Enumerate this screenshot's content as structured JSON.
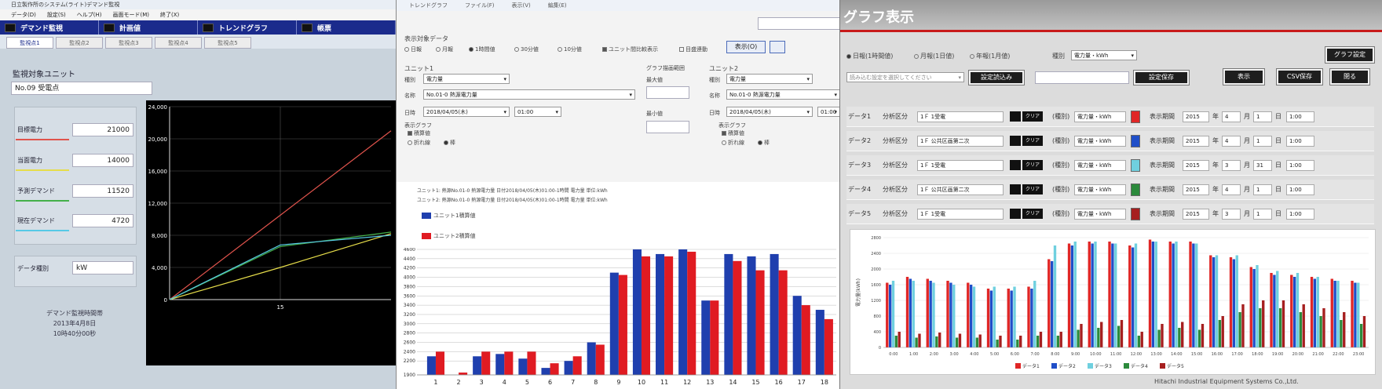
{
  "w1": {
    "title": "日立製作所のシステム(ライト)デマンド監視",
    "menu": [
      "データ(D)",
      "設定(S)",
      "ヘルプ(H)",
      "画面モード(M)",
      "終了(X)"
    ],
    "nav": [
      "デマンド監視",
      "計画値",
      "トレンドグラフ",
      "帳票"
    ],
    "tabs": [
      "監視点1",
      "監視点2",
      "監視点3",
      "監視点4",
      "監視点5"
    ],
    "unit_label": "監視対象ユニット",
    "unit_value": "No.09 受電点",
    "metrics": [
      {
        "label": "目標電力",
        "value": "21000",
        "color": "#e0534c"
      },
      {
        "label": "当面電力",
        "value": "14000",
        "color": "#e6dd4a"
      },
      {
        "label": "予測デマンド",
        "value": "11520",
        "color": "#44b04a"
      },
      {
        "label": "現在デマンド",
        "value": "4720",
        "color": "#57c9e6"
      }
    ],
    "interval_label": "データ種別",
    "interval_value": "kW",
    "footer": [
      "デマンド監視時間帯",
      "2013年4月8日",
      "10時40分00秒"
    ],
    "chart": {
      "yticks": [
        "24,000",
        "20,000",
        "16,000",
        "12,000",
        "8,000",
        "4,000",
        "0"
      ],
      "xtick": "15"
    }
  },
  "w2": {
    "title_items": [
      "トレンドグラフ",
      "ファイル(F)",
      "表示(V)",
      "編集(E)"
    ],
    "section_label": "表示対象データ",
    "period_radios": [
      "日報",
      "月報",
      "1時間値",
      "30分値",
      "10分値"
    ],
    "check_unit_compare": "ユニット間比較表示",
    "check_scale": "目盛連動",
    "unit1_label": "ユニット1",
    "unit2_label": "ユニット2",
    "kind_label": "種別",
    "kind_value": "電力量",
    "name_label": "名称",
    "name_value": "No.01-0 熱源電力量",
    "date_label": "日時",
    "date_value": "2018/04/05(木)",
    "time_value": "01:00",
    "graph_label": "表示グラフ",
    "graph_opts": [
      "積算値",
      "折れ線",
      "棒"
    ],
    "right_label": "グラフ描画範囲",
    "right_field_label": "最大値",
    "min_label": "最小値",
    "display_btn": "表示(O)",
    "info_line1": "ユニット1: 熱源No.01-0 熱源電力量  日付2018/04/05(木)01:00-1時間  電力量  単位:kWh",
    "info_line2": "ユニット2: 熱源No.01-0 熱源電力量  日付2018/04/05(木)01:00-1時間  電力量  単位:kWh",
    "legend": [
      {
        "name": "ユニット1積算値",
        "color": "#1f3fae"
      },
      {
        "name": "ユニット2積算値",
        "color": "#e01b22"
      }
    ]
  },
  "w3": {
    "title": "グラフ表示",
    "radios": [
      "日報(1時間値)",
      "月報(1日値)",
      "年報(1月値)"
    ],
    "kind_label": "種別",
    "kind_value": "電力量・kWh",
    "settings_btn": "グラフ設定",
    "load_placeholder": "読み込む設定を選択してください",
    "load_btn": "設定読込み",
    "save_btn": "設定保存",
    "show_btn": "表示",
    "csv_btn": "CSV保存",
    "close_btn": "閉る",
    "row_data_label": "データ",
    "row_kind_label": "(種別)",
    "row_time_label": "表示期間",
    "clear_label": "クリア",
    "rows": [
      {
        "idx": "1",
        "cat": "分析区分",
        "name": "1Ｆ 1受電",
        "kind": "電力量・kWh",
        "color": "#e02626",
        "y": "2015",
        "m": "4",
        "d": "1",
        "t": "1:00"
      },
      {
        "idx": "2",
        "cat": "分析区分",
        "name": "1Ｆ 公共区画第二次",
        "kind": "電力量・kWh",
        "color": "#1f4ec8",
        "y": "2015",
        "m": "4",
        "d": "1",
        "t": "1:00"
      },
      {
        "idx": "3",
        "cat": "分析区分",
        "name": "1Ｆ 1受電",
        "kind": "電力量・kWh",
        "color": "#6fd0df",
        "y": "2015",
        "m": "3",
        "d": "31",
        "t": "1:00"
      },
      {
        "idx": "4",
        "cat": "分析区分",
        "name": "1Ｆ 公共区画第二次",
        "kind": "電力量・kWh",
        "color": "#2c8a3c",
        "y": "2015",
        "m": "4",
        "d": "1",
        "t": "1:00"
      },
      {
        "idx": "5",
        "cat": "分析区分",
        "name": "1Ｆ 1受電",
        "kind": "電力量・kWh",
        "color": "#a61f1f",
        "y": "2015",
        "m": "3",
        "d": "1",
        "t": "1:00"
      }
    ],
    "chart_ylabel": "電力量(kWh)",
    "chart_legend": [
      "データ1",
      "データ2",
      "データ3",
      "データ4",
      "データ5"
    ],
    "footer": "Hitachi Industrial Equipment Systems Co.,Ltd."
  },
  "chart_data": [
    {
      "type": "line",
      "x": [
        0,
        15,
        30
      ],
      "ylim": [
        0,
        24000
      ],
      "yticks": [
        0,
        4000,
        8000,
        12000,
        16000,
        20000,
        24000
      ],
      "series": [
        {
          "name": "目標電力",
          "color": "#e0534c",
          "values": [
            0,
            10500,
            21000
          ]
        },
        {
          "name": "当面電力",
          "color": "#e6dd4a",
          "values": [
            0,
            4000,
            8200
          ]
        },
        {
          "name": "予測デマンド",
          "color": "#44b04a",
          "values": [
            0,
            6600,
            8400
          ]
        },
        {
          "name": "現在デマンド",
          "color": "#57c9e6",
          "values": [
            0,
            6800,
            8000
          ]
        }
      ],
      "grid": true
    },
    {
      "type": "bar",
      "categories": [
        "1",
        "2",
        "3",
        "4",
        "5",
        "6",
        "7",
        "8",
        "9",
        "10",
        "11",
        "12",
        "13",
        "14",
        "15",
        "16",
        "17",
        "18"
      ],
      "ylim": [
        1900,
        4600
      ],
      "yticks": [
        1900,
        2200,
        2400,
        2600,
        2800,
        3000,
        3200,
        3400,
        3600,
        3800,
        4000,
        4200,
        4400,
        4600
      ],
      "series": [
        {
          "name": "ユニット1積算値",
          "color": "#1f3fae",
          "values": [
            2300,
            1900,
            2300,
            2350,
            2250,
            2050,
            2200,
            2600,
            4100,
            4600,
            4500,
            4600,
            3500,
            4500,
            4450,
            4500,
            3600,
            3300
          ]
        },
        {
          "name": "ユニット2積算値",
          "color": "#e01b22",
          "values": [
            2400,
            1950,
            2400,
            2400,
            2400,
            2150,
            2300,
            2550,
            4050,
            4450,
            4450,
            4550,
            3500,
            4350,
            4150,
            4150,
            3400,
            3100
          ]
        }
      ],
      "grid": true
    },
    {
      "type": "bar",
      "ylabel": "電力量(kWh)",
      "categories": [
        "0:00",
        "1:00",
        "2:00",
        "3:00",
        "4:00",
        "5:00",
        "6:00",
        "7:00",
        "8:00",
        "9:00",
        "10:00",
        "11:00",
        "12:00",
        "13:00",
        "14:00",
        "15:00",
        "16:00",
        "17:00",
        "18:00",
        "19:00",
        "20:00",
        "21:00",
        "22:00",
        "23:00"
      ],
      "ylim": [
        0,
        2800
      ],
      "yticks": [
        0,
        400,
        800,
        1200,
        1600,
        2000,
        2400,
        2800
      ],
      "series": [
        {
          "name": "データ1",
          "color": "#e02626",
          "values": [
            1650,
            1800,
            1750,
            1700,
            1650,
            1500,
            1500,
            1550,
            2250,
            2650,
            2700,
            2700,
            2600,
            2750,
            2700,
            2700,
            2350,
            2300,
            2050,
            1900,
            1850,
            1800,
            1750,
            1700
          ]
        },
        {
          "name": "データ2",
          "color": "#1f4ec8",
          "values": [
            1600,
            1750,
            1700,
            1650,
            1600,
            1450,
            1450,
            1500,
            2200,
            2600,
            2650,
            2650,
            2550,
            2700,
            2650,
            2650,
            2300,
            2250,
            2000,
            1850,
            1800,
            1750,
            1700,
            1650
          ]
        },
        {
          "name": "データ3",
          "color": "#6fd0df",
          "values": [
            1700,
            1700,
            1650,
            1600,
            1550,
            1550,
            1550,
            1700,
            2600,
            2700,
            2700,
            2650,
            2650,
            2700,
            2700,
            2650,
            2350,
            2350,
            2100,
            1950,
            1900,
            1800,
            1700,
            1650
          ]
        },
        {
          "name": "データ4",
          "color": "#2c8a3c",
          "values": [
            300,
            250,
            280,
            250,
            250,
            200,
            200,
            300,
            300,
            450,
            500,
            550,
            300,
            450,
            500,
            450,
            700,
            900,
            1000,
            1000,
            900,
            800,
            700,
            600
          ]
        },
        {
          "name": "データ5",
          "color": "#a61f1f",
          "values": [
            400,
            350,
            380,
            350,
            330,
            300,
            300,
            400,
            400,
            600,
            650,
            700,
            400,
            600,
            650,
            600,
            800,
            1100,
            1200,
            1200,
            1100,
            1000,
            900,
            800
          ]
        }
      ],
      "legend": "bottom",
      "grid": true
    }
  ]
}
